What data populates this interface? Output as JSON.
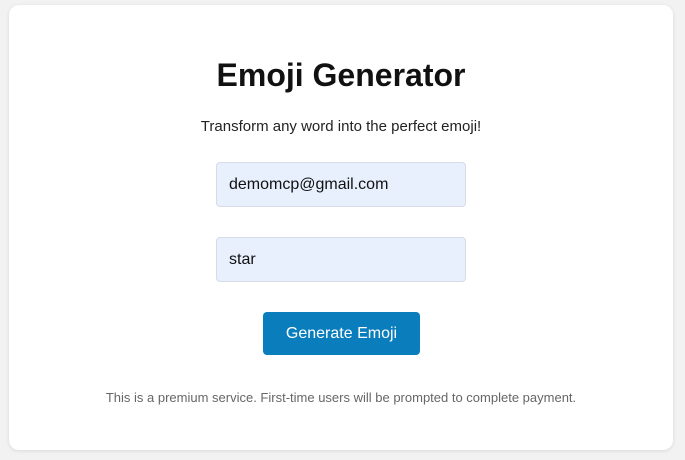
{
  "app": {
    "title": "Emoji Generator",
    "subtitle": "Transform any word into the perfect emoji!"
  },
  "form": {
    "email_value": "demomcp@gmail.com",
    "word_value": "star",
    "submit_label": "Generate Emoji"
  },
  "footer": {
    "note": "This is a premium service. First-time users will be prompted to complete payment."
  },
  "colors": {
    "button": "#0a7dbd",
    "input_bg": "#e8f0fe",
    "page_bg": "#f2f2f2"
  }
}
